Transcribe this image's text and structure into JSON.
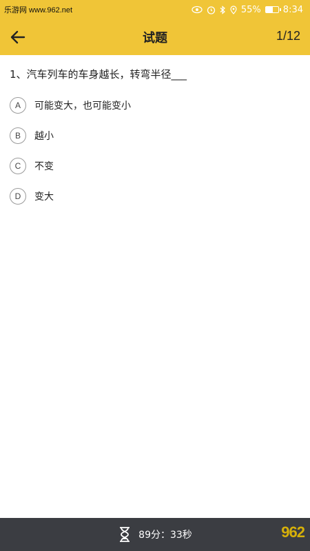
{
  "status_bar": {
    "watermark": "乐游网 www.962.net",
    "battery": "55%",
    "battery_level": 0.55,
    "time": "8:34"
  },
  "app_bar": {
    "title": "试题",
    "counter": "1/12"
  },
  "question": {
    "text": "1、汽车列车的车身越长，转弯半径___",
    "options": [
      {
        "letter": "A",
        "text": "可能变大，也可能变小"
      },
      {
        "letter": "B",
        "text": "越小"
      },
      {
        "letter": "C",
        "text": "不变"
      },
      {
        "letter": "D",
        "text": "变大"
      }
    ]
  },
  "timer": {
    "text": "89分：33秒"
  },
  "colors": {
    "accent": "#f0c537",
    "bottom_bar": "#3b3d42"
  }
}
